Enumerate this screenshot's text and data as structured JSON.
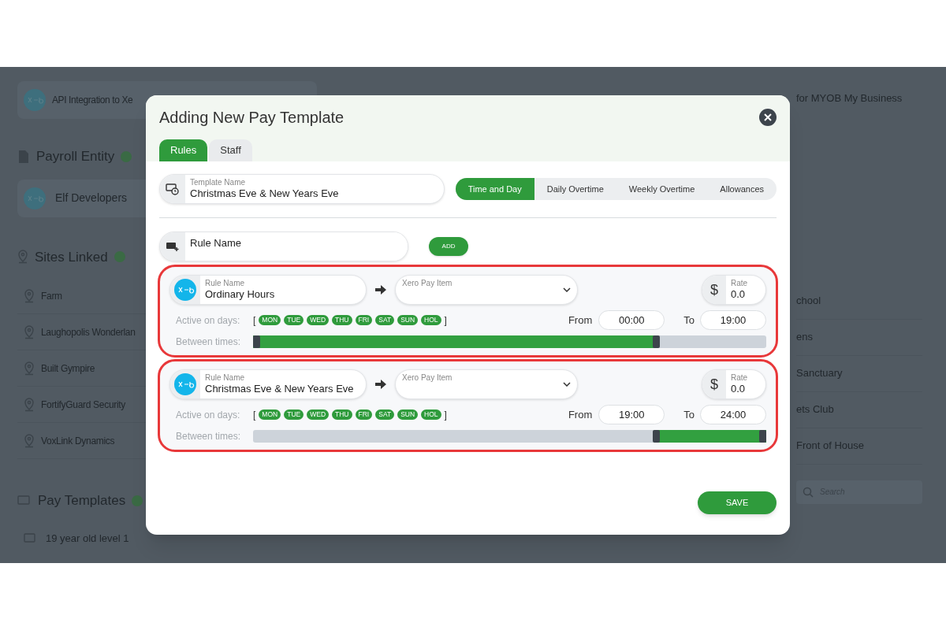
{
  "background": {
    "integration_card": {
      "text": "API Integration to Xe"
    },
    "payroll_entity": {
      "heading": "Payroll Entity",
      "entity": "Elf Developers"
    },
    "sites": {
      "heading": "Sites Linked",
      "items": [
        "Farm",
        "Laughopolis Wonderlan",
        "Built Gympire",
        "FortifyGuard Security",
        "VoxLink Dynamics"
      ]
    },
    "pay_templates": {
      "heading": "Pay Templates",
      "items": [
        "19 year old level 1"
      ]
    },
    "right_column": {
      "integration_text": "for MYOB My Business",
      "items": [
        "chool",
        "ens",
        "Sanctuary",
        "ets Club",
        "Front of House"
      ],
      "search": {
        "placeholder": "Search"
      }
    }
  },
  "modal": {
    "title": "Adding New Pay Template",
    "tabs": [
      {
        "label": "Rules",
        "selected": true
      },
      {
        "label": "Staff",
        "selected": false
      }
    ],
    "template_name": {
      "label": "Template Name",
      "value": "Christmas Eve & New Years Eve"
    },
    "rule_tabs": [
      {
        "label": "Time and Day",
        "selected": true
      },
      {
        "label": "Daily Overtime",
        "selected": false
      },
      {
        "label": "Weekly Overtime",
        "selected": false
      },
      {
        "label": "Allowances",
        "selected": false
      }
    ],
    "new_rule": {
      "placeholder": "Rule Name",
      "add_button": "ADD"
    },
    "rules": [
      {
        "name_label": "Rule Name",
        "name": "Ordinary Hours",
        "pay_item_label": "Xero Pay Item",
        "currency": "$",
        "rate_label": "Rate",
        "rate": "0.0",
        "days_label": "Active on days:",
        "bracket_open": "[",
        "bracket_close": "]",
        "days": [
          {
            "label": "MON",
            "selected": true
          },
          {
            "label": "TUE",
            "selected": true
          },
          {
            "label": "WED",
            "selected": true
          },
          {
            "label": "THU",
            "selected": true
          },
          {
            "label": "FRI",
            "selected": true
          },
          {
            "label": "SAT",
            "selected": true
          },
          {
            "label": "SUN",
            "selected": true
          },
          {
            "label": "HOL",
            "selected": true
          }
        ],
        "from_label": "From",
        "from": "00:00",
        "to_label": "To",
        "to": "19:00",
        "times_label": "Between times:",
        "handles": [
          {
            "level": 0
          },
          {
            "level": 0.79
          }
        ]
      },
      {
        "name_label": "Rule Name",
        "name": "Christmas Eve & New Years Eve",
        "pay_item_label": "Xero Pay Item",
        "currency": "$",
        "rate_label": "Rate",
        "rate": "0.0",
        "days_label": "Active on days:",
        "bracket_open": "[",
        "bracket_close": "]",
        "days": [
          {
            "label": "MON",
            "selected": true
          },
          {
            "label": "TUE",
            "selected": true
          },
          {
            "label": "WED",
            "selected": true
          },
          {
            "label": "THU",
            "selected": true
          },
          {
            "label": "FRI",
            "selected": true
          },
          {
            "label": "SAT",
            "selected": true
          },
          {
            "label": "SUN",
            "selected": true
          },
          {
            "label": "HOL",
            "selected": true
          }
        ],
        "from_label": "From",
        "from": "19:00",
        "to_label": "To",
        "to": "24:00",
        "times_label": "Between times:",
        "handles": [
          {
            "level": 0.79
          },
          {
            "level": 1
          }
        ]
      }
    ],
    "save_button": "SAVE"
  }
}
